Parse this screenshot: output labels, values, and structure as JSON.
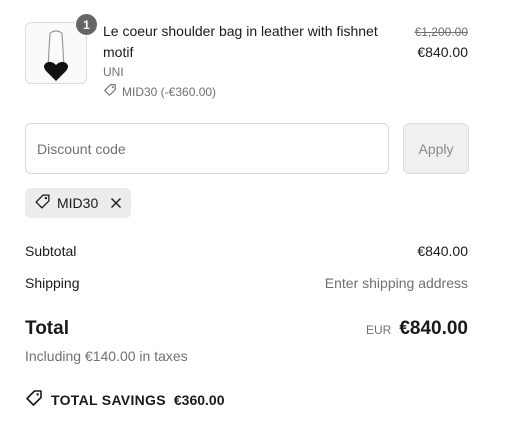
{
  "product": {
    "quantity": "1",
    "title": "Le coeur shoulder bag in leather with fishnet motif",
    "variant": "UNI",
    "discount_line": "MID30 (-€360.00)",
    "price_original": "€1,200.00",
    "price_current": "€840.00"
  },
  "discount": {
    "placeholder": "Discount code",
    "apply_label": "Apply",
    "applied_code": "MID30"
  },
  "summary": {
    "subtotal_label": "Subtotal",
    "subtotal_value": "€840.00",
    "shipping_label": "Shipping",
    "shipping_value": "Enter shipping address",
    "total_label": "Total",
    "total_currency": "EUR",
    "total_value": "€840.00",
    "taxes_note": "Including €140.00 in taxes",
    "savings_label": "TOTAL SAVINGS",
    "savings_value": "€360.00"
  },
  "icons": {
    "tag": "tag-icon",
    "close": "close-icon",
    "savings": "savings-tag-icon"
  }
}
